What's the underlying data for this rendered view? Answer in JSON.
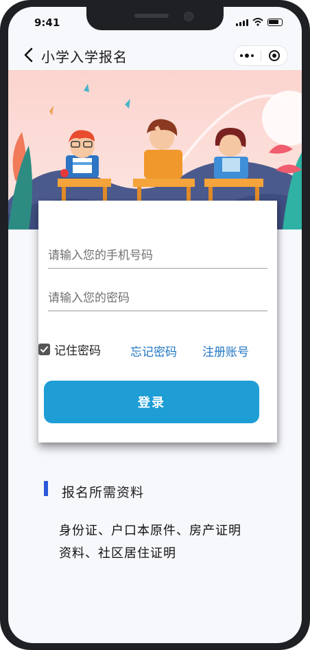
{
  "status": {
    "time": "9:41"
  },
  "nav": {
    "title": "小学入学报名"
  },
  "form": {
    "phone_placeholder": "请输入您的手机号码",
    "password_placeholder": "请输入您的密码",
    "remember_label": "记住密码",
    "remember_checked": true,
    "forgot_label": "忘记密码",
    "register_label": "注册账号",
    "login_label": "登录"
  },
  "section": {
    "title": "报名所需资料",
    "body": "身份证、户口本原件、房产证明资料、社区居住证明"
  },
  "colors": {
    "accent": "#1e9ed4",
    "link": "#1f77c4",
    "section_bar": "#2b58d8"
  },
  "icons": [
    "back-icon",
    "more-icon",
    "close-target-icon",
    "checkmark-icon"
  ]
}
